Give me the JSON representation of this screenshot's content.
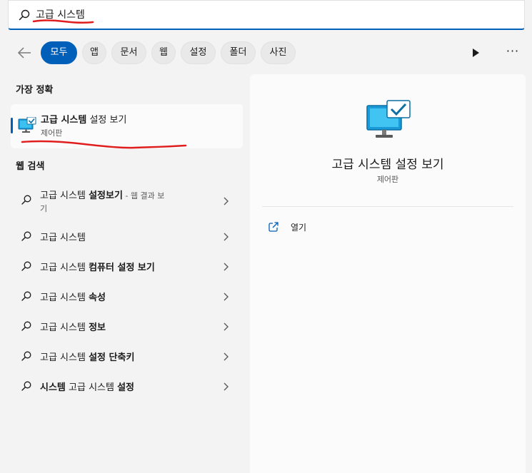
{
  "search": {
    "query": "고급 시스템",
    "icon": "search-icon"
  },
  "filters": {
    "items": [
      "모두",
      "앱",
      "문서",
      "웹",
      "설정",
      "폴더",
      "사진"
    ],
    "active_index": 0
  },
  "best_match": {
    "heading": "가장 정확",
    "title_bold": "고급 시스템",
    "title_rest": " 설정 보기",
    "subtitle": "제어판"
  },
  "web_search": {
    "heading": "웹 검색",
    "items": [
      {
        "bold": "설정보기",
        "prefix": "고급 시스템 ",
        "suffix_dim": " - 웹 결과 보",
        "line2": "기"
      },
      {
        "prefix": "고급 시스템",
        "bold": ""
      },
      {
        "prefix": "고급 시스템 ",
        "bold": "컴퓨터 설정 보기"
      },
      {
        "prefix": "고급 시스템 ",
        "bold": "속성"
      },
      {
        "prefix": "고급 시스템 ",
        "bold": "정보"
      },
      {
        "prefix": "고급 시스템 ",
        "bold": "설정 단축키"
      },
      {
        "bold_lead": "시스템",
        "prefix": " 고급 시스템 ",
        "bold": "설정"
      }
    ]
  },
  "detail": {
    "title": "고급 시스템 설정 보기",
    "subtitle": "제어판",
    "open_label": "열기"
  },
  "colors": {
    "accent": "#005fb8",
    "annotation": "#e01e1e"
  }
}
